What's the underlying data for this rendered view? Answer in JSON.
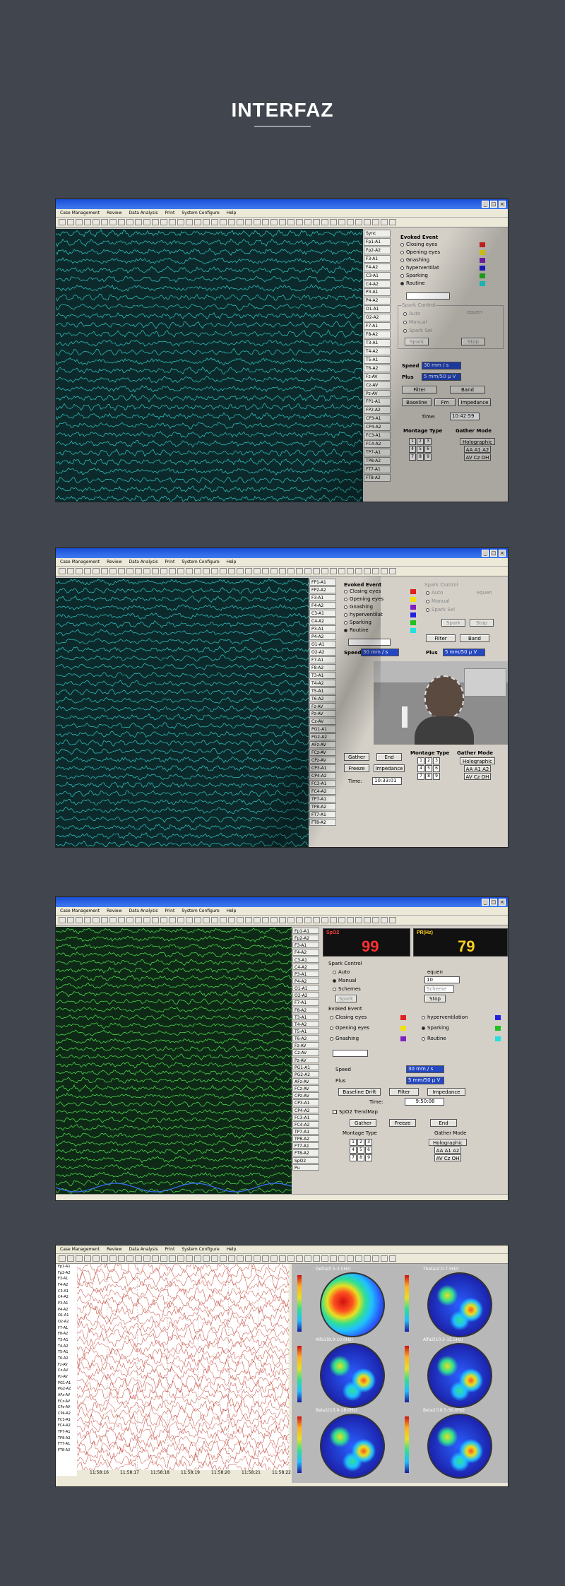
{
  "page_title": "INTERFAZ",
  "screens": [
    {
      "menu": [
        "Case Management",
        "Review",
        "Data Analysis",
        "Print",
        "System Configure",
        "Help"
      ],
      "channels": [
        "Sync",
        "Fp1-A1",
        "Fp2-A2",
        "F3-A1",
        "F4-A2",
        "C3-A1",
        "C4-A2",
        "P3-A1",
        "P4-A2",
        "O1-A1",
        "O2-A2",
        "F7-A1",
        "F8-A2",
        "T3-A1",
        "T4-A2",
        "T5-A1",
        "T6-A2",
        "Fz-AV",
        "Cz-AV",
        "Pz-AV",
        "FP1-A1",
        "FP2-A2",
        "CP3-A1",
        "CP4-A2",
        "FC3-A1",
        "FC4-A2",
        "TP7-A1",
        "TP8-A2",
        "FT7-A1",
        "FT8-A2"
      ],
      "evoked_title": "Evoked Event",
      "events": [
        {
          "label": "Closing eyes",
          "color": "#e02020"
        },
        {
          "label": "Opening eyes",
          "color": "#f0e010"
        },
        {
          "label": "Gnashing",
          "color": "#8020c0"
        },
        {
          "label": "hyperventilat",
          "color": "#2020e0"
        },
        {
          "label": "Sparking",
          "color": "#20c020"
        },
        {
          "label": "Routine",
          "color": "#20e0e0"
        }
      ],
      "spark_title": "Spark Control",
      "spark_auto": "Auto",
      "spark_manual": "Manual",
      "spark_schemes": "Spark Sel",
      "equen": "equen",
      "spark_btn": "Spark",
      "stop_btn": "Stop",
      "speed_label": "Speed",
      "speed_value": "30 mm / s",
      "plus_label": "Plus",
      "plus_value": "5 mm/50 μ V",
      "filter_btn": "Filter",
      "band_btn": "Band",
      "baseline_btn": "Baseline",
      "fm_btn": "Fm",
      "impedance_btn": "Impedance",
      "time_label": "Time:",
      "time_value": "10:42:59",
      "montage_label": "Montage Type",
      "gather_label": "Gather Mode",
      "keys": [
        "1",
        "2",
        "3",
        "4",
        "5",
        "6",
        "7",
        "8",
        "9"
      ],
      "holographic": "Holographic",
      "aa": "AA A1 A2",
      "avcz": "AV Cz OH"
    },
    {
      "menu": [
        "Case Management",
        "Review",
        "Data Analysis",
        "Print",
        "System Configure",
        "Help"
      ],
      "channels": [
        "FP1-A1",
        "FP2-A2",
        "F3-A1",
        "F4-A2",
        "C3-A1",
        "C4-A2",
        "P3-A1",
        "P4-A2",
        "O1-A1",
        "O2-A2",
        "F7-A1",
        "F8-A2",
        "T3-A1",
        "T4-A2",
        "T5-A1",
        "T6-A2",
        "Fz-AV",
        "Pz-AV",
        "Cz-AV",
        "PG1-A1",
        "PG2-A2",
        "AFz-AV",
        "FCz-AV",
        "CPz-AV",
        "CP3-A1",
        "CP4-A2",
        "FC3-A1",
        "FC4-A2",
        "TP7-A1",
        "TP8-A2",
        "FT7-A1",
        "FT8-A2"
      ],
      "evoked_title": "Evoked Event",
      "events": [
        {
          "label": "Closing eyes",
          "color": "#e02020"
        },
        {
          "label": "Opening eyes",
          "color": "#f0e010"
        },
        {
          "label": "Gnashing",
          "color": "#8020c0"
        },
        {
          "label": "hyperventilat",
          "color": "#2020e0"
        },
        {
          "label": "Sparking",
          "color": "#20c020"
        },
        {
          "label": "Routine",
          "color": "#20e0e0"
        }
      ],
      "spark_title": "Spark Control",
      "spark_auto": "Auto",
      "spark_manual": "Manual",
      "spark_schemes": "Spark Sel",
      "equen": "equen",
      "spark_btn": "Spark",
      "stop_btn": "Stop",
      "filter_btn": "Filter",
      "band_btn": "Band",
      "speed_label": "Speed",
      "speed_value": "30 mm / s",
      "plus_label": "Plus",
      "plus_value": "5 mm/50 μ V",
      "gather_btn": "Gather",
      "end_btn": "End",
      "freeze_btn": "Freeze",
      "impedance_btn": "Impedance",
      "time_label": "Time:",
      "time_value": "10:33:01",
      "montage_label": "Montage Type",
      "gather_label": "Gather Mode",
      "keys": [
        "1",
        "2",
        "3",
        "4",
        "5",
        "6",
        "7",
        "8",
        "9"
      ],
      "holographic": "Holographic",
      "aa": "AA A1 A2",
      "avcz": "AV Cz OH"
    },
    {
      "menu": [
        "Case Management",
        "Review",
        "Data Analysis",
        "Print",
        "System Configure",
        "Help"
      ],
      "channels": [
        "Fp1-A1",
        "Fp2-A2",
        "F3-A1",
        "F4-A2",
        "C3-A1",
        "C4-A2",
        "P3-A1",
        "P4-A2",
        "O1-A1",
        "O2-A2",
        "F7-A1",
        "F8-A2",
        "T3-A1",
        "T4-A2",
        "T5-A1",
        "T6-A2",
        "Fz-AV",
        "Cz-AV",
        "Pz-AV",
        "PG1-A1",
        "PG2-A2",
        "AFz-AV",
        "FCz-AV",
        "CPz-AV",
        "CP3-A1",
        "CP4-A2",
        "FC3-A1",
        "FC4-A2",
        "TP7-A1",
        "TP8-A2",
        "FT7-A1",
        "FT8-A2",
        "SpO2",
        "Pu"
      ],
      "spo2_label": "SpO2",
      "spo2_value": "99",
      "pr_label": "PR(Hz)",
      "pr_value": "79",
      "spark_title": "Spark Control",
      "spark_auto": "Auto",
      "spark_manual": "Manual",
      "spark_schemes": "Schemes",
      "equen": "equen",
      "equen_value": "10",
      "schemes_select": "Scheme",
      "spark_btn": "Spark",
      "stop_btn": "Stop",
      "evoked_title": "Evoked Event",
      "events": [
        {
          "label": "Closing eyes",
          "color": "#e02020"
        },
        {
          "label": "Opening eyes",
          "color": "#f0e010"
        },
        {
          "label": "Gnashing",
          "color": "#8020c0"
        },
        {
          "label": "hyperventilation",
          "color": "#2020e0"
        },
        {
          "label": "Sparking",
          "color": "#20c020"
        },
        {
          "label": "Routine",
          "color": "#20e0e0"
        }
      ],
      "speed_label": "Speed",
      "speed_value": "30 mm / s",
      "plus_label": "Plus",
      "plus_value": "5 mm/50 μ V",
      "baseline_btn": "Baseline Drift",
      "filter_btn": "Filter",
      "impedance_btn": "Impedance",
      "time_label": "Time:",
      "time_value": "9:50:08",
      "trend_label": "SpO2 TrendMap",
      "gather_btn": "Gather",
      "freeze_btn": "Freeze",
      "end_btn": "End",
      "montage_label": "Montage Type",
      "gather_label": "Gather Mode",
      "keys": [
        "1",
        "2",
        "3",
        "4",
        "5",
        "6",
        "7",
        "8",
        "9"
      ],
      "holographic": "Holographic",
      "aa": "AA A1 A2",
      "avcz": "AV Cz OH"
    },
    {
      "menu": [
        "Case Management",
        "Review",
        "Data Analysis",
        "Print",
        "System Configure",
        "Help"
      ],
      "channels": [
        "Fp1-A1",
        "Fp2-A2",
        "F3-A1",
        "F4-A2",
        "C3-A1",
        "C4-A2",
        "P3-A1",
        "P4-A2",
        "O1-A1",
        "O2-A2",
        "F7-A1",
        "F8-A2",
        "T3-A1",
        "T4-A2",
        "T5-A1",
        "T6-A2",
        "Fz-AV",
        "Cz-AV",
        "Pz-AV",
        "PG1-A1",
        "PG2-A2",
        "AFz-AV",
        "FCz-AV",
        "CPz-AV",
        "CP4-A2",
        "FC3-A1",
        "FC4-A2",
        "TP7-A1",
        "TP8-A2",
        "FT7-A1",
        "FT8-A2"
      ],
      "times": [
        "11:58:16",
        "11:58:17",
        "11:58:18",
        "11:58:19",
        "11:58:20",
        "11:58:21",
        "11:58:22"
      ],
      "maps": [
        {
          "title": "Delta(0.5-3.5Hz)"
        },
        {
          "title": "Theta(4.0-7.5Hz)"
        },
        {
          "title": "Alfa1(8.0-10.0Hz)"
        },
        {
          "title": "Alfa2(10.5-12.5Hz)"
        },
        {
          "title": "Beta1(13.0-18.0Hz)"
        },
        {
          "title": "Beta2(18.5-30.0Hz)"
        }
      ]
    }
  ]
}
